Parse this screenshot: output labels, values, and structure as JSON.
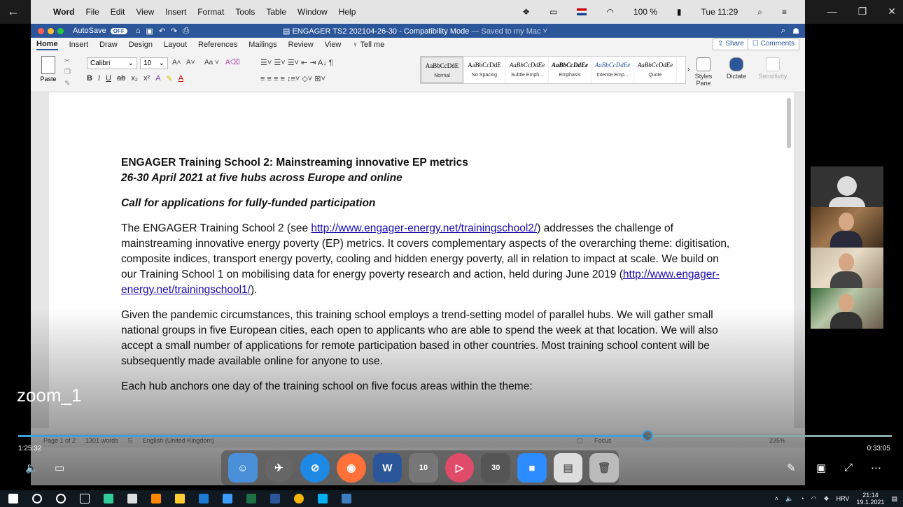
{
  "player": {
    "back_icon": "back-arrow-icon",
    "overlay_label": "zoom_1",
    "elapsed": "1:25:32",
    "total": "0:33:05",
    "progress": 0.72
  },
  "mac_menubar": {
    "app_name": "Word",
    "items": [
      "File",
      "Edit",
      "View",
      "Insert",
      "Format",
      "Tools",
      "Table",
      "Window",
      "Help"
    ],
    "battery": "100 %",
    "clock": "Tue 11:29"
  },
  "word_titlebar": {
    "autosave": "AutoSave",
    "autosave_state": "OFF",
    "doc_title": "ENGAGER TS2 202104-26-30",
    "mode": " - Compatibility Mode",
    "saved": " — Saved to my Mac ˅"
  },
  "ribbon_tabs": {
    "items": [
      "Home",
      "Insert",
      "Draw",
      "Design",
      "Layout",
      "References",
      "Mailings",
      "Review",
      "View",
      "Tell me"
    ],
    "share": "Share",
    "comments": "Comments"
  },
  "ribbon": {
    "paste": "Paste",
    "font": "Calibri",
    "font_size": "10",
    "styles": [
      {
        "sample": "AaBbCcDdE",
        "name": "Normal"
      },
      {
        "sample": "AaBbCcDdE",
        "name": "No Spacing"
      },
      {
        "sample": "AaBbCcDdEe",
        "name": "Subtle Emph..."
      },
      {
        "sample": "AaBbCcDdEe",
        "name": "Emphasis"
      },
      {
        "sample": "AaBbCcDdEe",
        "name": "Intense Emp..."
      },
      {
        "sample": "AaBbCcDdEe",
        "name": "Quote"
      }
    ],
    "styles_pane": "Styles Pane",
    "dictate": "Dictate",
    "sensitivity": "Sensitivity"
  },
  "document": {
    "title": "ENGAGER Training School 2: Mainstreaming innovative EP metrics",
    "subtitle": "26-30 April 2021 at five hubs across Europe and online",
    "call": "Call for applications for fully-funded participation",
    "p1_a": "The ENGAGER Training School 2 (see ",
    "p1_link": "http://www.engager-energy.net/trainingschool2/",
    "p1_b": ") addresses the challenge of mainstreaming innovative energy poverty (EP) metrics. It covers complementary aspects of the overarching theme: digitisation, composite indices, transport energy poverty, cooling and hidden energy poverty, all in relation to impact at scale. We build on our Training School 1 on mobilising data for energy poverty research and action, held during June 2019 (",
    "p1_link2": "http://www.engager-energy.net/trainingschool1/",
    "p1_c": ").",
    "p2": "Given the pandemic circumstances, this training school employs a trend-setting model of parallel hubs. We will gather small national groups in five European cities, each open to applicants who are able to spend the week at that location. We will also accept a small number of applications for remote participation based in other countries. Most training school content will be subsequently made available online for anyone to use.",
    "p3": "Each hub anchors one day of the training school on five focus areas within the theme:"
  },
  "statusbar": {
    "page": "Page 1 of 2",
    "words": "1301 words",
    "language": "English (United Kingdom)",
    "focus": "Focus",
    "zoom": "235%"
  },
  "dock": {
    "rewind": "10",
    "forward": "30"
  },
  "taskbar": {
    "lang": "HRV",
    "time": "21:14",
    "date": "19.1.2021"
  },
  "colors": {
    "word_blue": "#2b579a",
    "link": "#1a0dab",
    "progress": "#3ba0e0"
  }
}
